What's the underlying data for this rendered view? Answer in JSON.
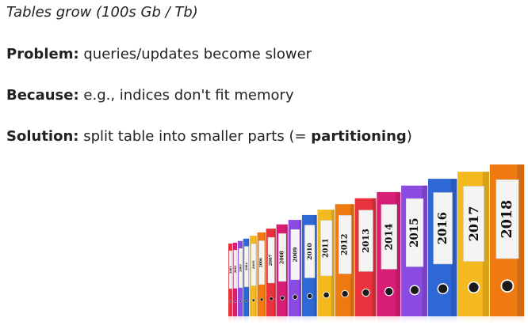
{
  "lines": {
    "intro": "Tables grow (100s Gb / Tb)",
    "problem_label": "Problem:",
    "problem_text": " queries/updates become slower",
    "because_label": "Because:",
    "because_text": " e.g., indices don't fit memory",
    "solution_label": "Solution:",
    "solution_text": " split table into smaller parts (= ",
    "solution_bold": "partitioning",
    "solution_end": ")"
  },
  "image": {
    "binder_years": [
      "2001",
      "2002",
      "2003",
      "2004",
      "2005",
      "2006",
      "2007",
      "2008",
      "2009",
      "2010",
      "2011",
      "2012",
      "2013",
      "2014",
      "2015",
      "2016",
      "2017",
      "2018"
    ],
    "colors": {
      "orange": "#f07a12",
      "yellow": "#f4b91e",
      "blue": "#2e67d6",
      "purple": "#8a4be0",
      "magenta": "#d81d74",
      "red": "#e8323c",
      "label": "#f4f4f4"
    }
  }
}
